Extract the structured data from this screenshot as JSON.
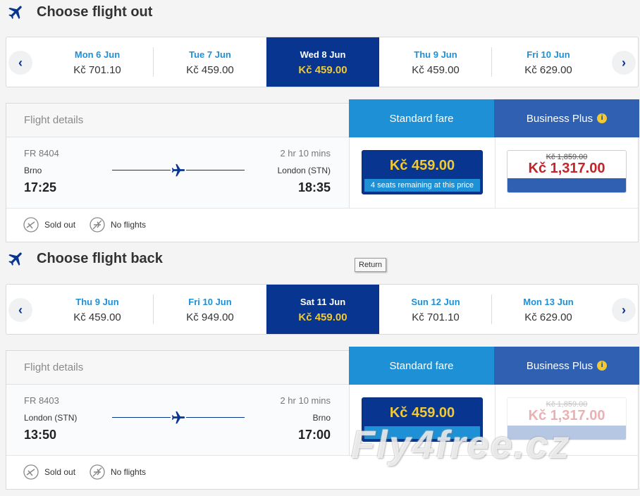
{
  "outbound": {
    "title": "Choose flight out",
    "dates": [
      {
        "day": "Mon 6 Jun",
        "price": "Kč 701.10"
      },
      {
        "day": "Tue 7 Jun",
        "price": "Kč 459.00"
      },
      {
        "day": "Wed 8 Jun",
        "price": "Kč 459.00",
        "selected": true
      },
      {
        "day": "Thu 9 Jun",
        "price": "Kč 459.00"
      },
      {
        "day": "Fri 10 Jun",
        "price": "Kč 629.00"
      }
    ],
    "details_label": "Flight details",
    "standard_fare_label": "Standard fare",
    "business_label": "Business Plus",
    "flight_number": "FR 8404",
    "duration": "2 hr 10 mins",
    "from": "Brno",
    "to": "London (STN)",
    "depart": "17:25",
    "arrive": "18:35",
    "standard_price": "Kč 459.00",
    "seats_note": "4 seats remaining at this price",
    "business_old_price": "Kč 1,859.00",
    "business_price": "Kč 1,317.00",
    "legend_sold_out": "Sold out",
    "legend_no_flights": "No flights"
  },
  "inbound": {
    "title": "Choose flight back",
    "dates": [
      {
        "day": "Thu 9 Jun",
        "price": "Kč 459.00"
      },
      {
        "day": "Fri 10 Jun",
        "price": "Kč 949.00"
      },
      {
        "day": "Sat 11 Jun",
        "price": "Kč 459.00",
        "selected": true
      },
      {
        "day": "Sun 12 Jun",
        "price": "Kč 701.10"
      },
      {
        "day": "Mon 13 Jun",
        "price": "Kč 629.00"
      }
    ],
    "details_label": "Flight details",
    "standard_fare_label": "Standard fare",
    "business_label": "Business Plus",
    "flight_number": "FR 8403",
    "duration": "2 hr 10 mins",
    "from": "London (STN)",
    "to": "Brno",
    "depart": "13:50",
    "arrive": "17:00",
    "standard_price": "Kč 459.00",
    "business_old_price": "Kč 1,859.00",
    "business_price": "Kč 1,317.00",
    "legend_sold_out": "Sold out",
    "legend_no_flights": "No flights"
  },
  "tooltip": "Return",
  "watermark": "Fly4free.cz",
  "icons": {
    "section": "plane-icon",
    "nav_prev": "chevron-left-icon",
    "nav_next": "chevron-right-icon",
    "info": "info-icon",
    "sold_out": "sold-out-icon",
    "no_flights": "no-flights-icon"
  },
  "colors": {
    "navy": "#073590",
    "blue": "#1e90d6",
    "business_blue": "#3060b2",
    "yellow": "#f1c933",
    "red": "#c4232a"
  }
}
